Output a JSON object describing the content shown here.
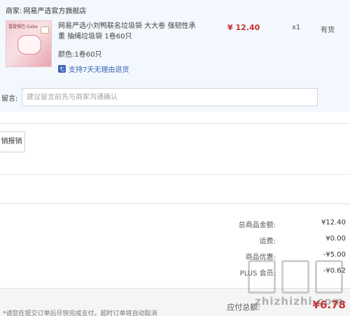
{
  "order": {
    "merchant_label": "商家:",
    "merchant_name": "网易严选官方旗舰店",
    "product": {
      "image_title": "雷霆嘎巴 Gaba",
      "name": "网易严选小刘鸭联名垃圾袋 大大卷 强韧性承重 抽绳垃圾袋 1卷60只",
      "spec_label": "颜色:",
      "spec_value": "1卷60只",
      "return_icon": "七",
      "return_policy": "支持7天无理由退货",
      "price": "¥ 12.40",
      "quantity": "x1",
      "stock": "有货"
    },
    "remark": {
      "label": "留言:",
      "placeholder": "建议留言前先与商家沟通确认"
    }
  },
  "invoice": {
    "button_label": "销报销"
  },
  "summary": [
    {
      "label": "总商品金额:",
      "value": "¥12.40"
    },
    {
      "label": "运费:",
      "value": "¥0.00"
    },
    {
      "label": "商品优惠:",
      "value": "-¥5.00"
    },
    {
      "label": "PLUS 会员:",
      "value": "-¥0.62"
    }
  ],
  "payable": {
    "label": "应付总额:",
    "value": "¥6.78"
  },
  "footer": {
    "note": "*请您在提交订单后尽快完成支付，超时订单将自动取消"
  },
  "watermark": {
    "text": "zhizhizhi.com"
  },
  "colors": {
    "accent": "#c8302d",
    "link": "#3b62b8",
    "order_bg": "#f2f8fd"
  }
}
